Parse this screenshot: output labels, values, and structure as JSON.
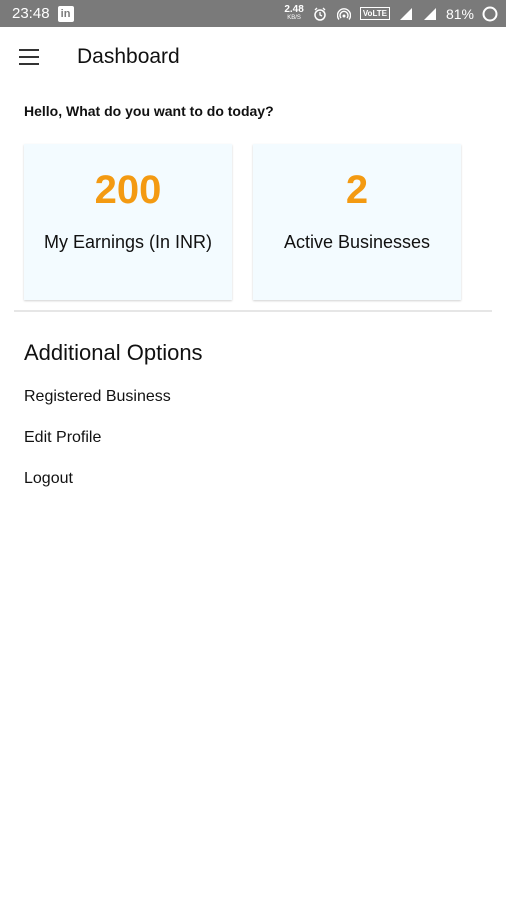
{
  "status_bar": {
    "time": "23:48",
    "linkedin_icon_text": "in",
    "speed_value": "2.48",
    "speed_unit": "KB/S",
    "volte": "VoLTE",
    "battery_percent": "81%"
  },
  "app_bar": {
    "title": "Dashboard"
  },
  "greeting": "Hello, What do you want to do today?",
  "cards": [
    {
      "value": "200",
      "label": "My Earnings (In INR)"
    },
    {
      "value": "2",
      "label": "Active Businesses"
    }
  ],
  "colors": {
    "accent": "#f39a12",
    "card_bg": "#f3fbff",
    "status_bar": "#7a7a7a"
  },
  "additional_options": {
    "title": "Additional Options",
    "items": [
      "Registered Business",
      "Edit Profile",
      "Logout"
    ]
  }
}
